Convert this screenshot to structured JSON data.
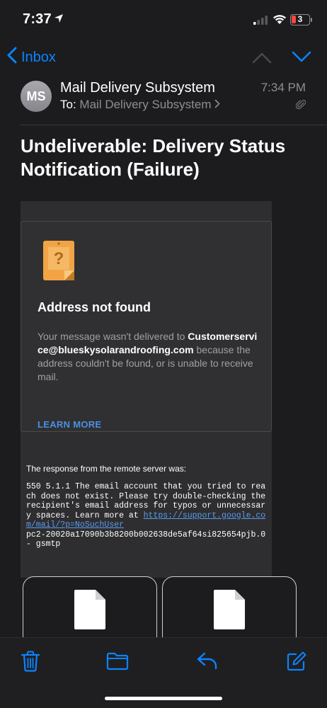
{
  "status_bar": {
    "time": "7:37",
    "battery_level": "3",
    "icons": [
      "location-arrow-icon",
      "signal-icon",
      "wifi-icon",
      "battery-icon"
    ]
  },
  "nav": {
    "back_label": "Inbox",
    "icons": [
      "chevron-left-icon",
      "chevron-up-icon",
      "chevron-down-icon"
    ]
  },
  "message": {
    "avatar_initials": "MS",
    "sender": "Mail Delivery Subsystem",
    "to_label": "To:",
    "recipient": "Mail Delivery Subsystem",
    "time": "7:34 PM",
    "subject": "Undeliverable: Delivery Status Notification (Failure)"
  },
  "body": {
    "card_title": "Address not found",
    "text_before": "Your message wasn't delivered to ",
    "address": "Customerservice@blueskysolarandroofing.com",
    "text_after": " because the address couldn't be found, or is unable to receive mail.",
    "learn_more": "LEARN MORE",
    "response_label": "The response from the remote server was:",
    "response_text": "550 5.1.1 The email account that you tried to reach does not exist. Please try double-checking the recipient's email address for typos or unnecessary spaces. Learn more at ",
    "response_link": "https://support.google.com/mail/?p=NoSuchUser",
    "response_tail": "\npc2-20020a17090b3b8200b002638de5af64si825654pjb.0 - gsmtp"
  },
  "toolbar": {
    "icons": [
      "trash-icon",
      "folder-icon",
      "reply-icon",
      "compose-icon"
    ]
  },
  "colors": {
    "accent": "#0a84ff",
    "background": "#1c1c1e",
    "link": "#4a90e2"
  }
}
